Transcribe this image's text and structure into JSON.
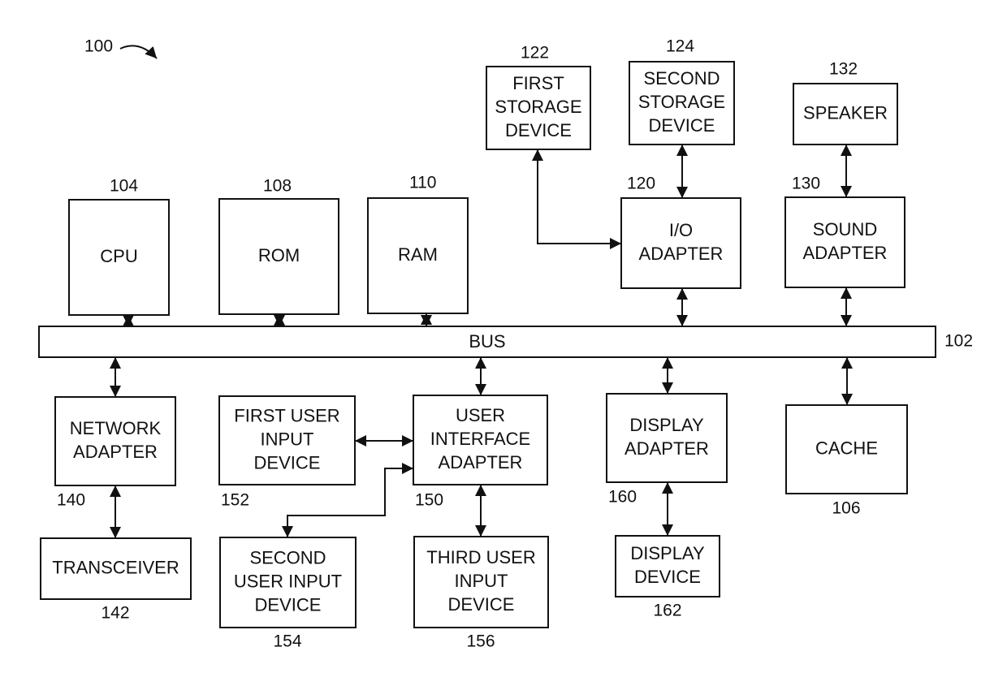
{
  "figure": {
    "ref": "100",
    "bus": {
      "ref": "102",
      "label": "BUS"
    },
    "blocks": {
      "cpu": {
        "ref": "104",
        "lines": [
          "CPU"
        ]
      },
      "rom": {
        "ref": "108",
        "lines": [
          "ROM"
        ]
      },
      "ram": {
        "ref": "110",
        "lines": [
          "RAM"
        ]
      },
      "first_storage": {
        "ref": "122",
        "lines": [
          "FIRST",
          "STORAGE",
          "DEVICE"
        ]
      },
      "second_storage": {
        "ref": "124",
        "lines": [
          "SECOND",
          "STORAGE",
          "DEVICE"
        ]
      },
      "speaker": {
        "ref": "132",
        "lines": [
          "SPEAKER"
        ]
      },
      "io_adapter": {
        "ref": "120",
        "lines": [
          "I/O",
          "ADAPTER"
        ]
      },
      "sound_adapter": {
        "ref": "130",
        "lines": [
          "SOUND",
          "ADAPTER"
        ]
      },
      "network_adapter": {
        "ref": "140",
        "lines": [
          "NETWORK",
          "ADAPTER"
        ]
      },
      "first_uid": {
        "ref": "152",
        "lines": [
          "FIRST USER",
          "INPUT",
          "DEVICE"
        ]
      },
      "ui_adapter": {
        "ref": "150",
        "lines": [
          "USER",
          "INTERFACE",
          "ADAPTER"
        ]
      },
      "display_adapter": {
        "ref": "160",
        "lines": [
          "DISPLAY",
          "ADAPTER"
        ]
      },
      "cache": {
        "ref": "106",
        "lines": [
          "CACHE"
        ]
      },
      "transceiver": {
        "ref": "142",
        "lines": [
          "TRANSCEIVER"
        ]
      },
      "second_uid": {
        "ref": "154",
        "lines": [
          "SECOND",
          "USER INPUT",
          "DEVICE"
        ]
      },
      "third_uid": {
        "ref": "156",
        "lines": [
          "THIRD USER",
          "INPUT",
          "DEVICE"
        ]
      },
      "display_device": {
        "ref": "162",
        "lines": [
          "DISPLAY",
          "DEVICE"
        ]
      }
    },
    "connections": [
      {
        "from": "cpu",
        "to": "bus",
        "direction": "bidirectional"
      },
      {
        "from": "rom",
        "to": "bus",
        "direction": "bidirectional"
      },
      {
        "from": "ram",
        "to": "bus",
        "direction": "bidirectional"
      },
      {
        "from": "io_adapter",
        "to": "bus",
        "direction": "bidirectional"
      },
      {
        "from": "sound_adapter",
        "to": "bus",
        "direction": "bidirectional"
      },
      {
        "from": "second_storage",
        "to": "io_adapter",
        "direction": "bidirectional"
      },
      {
        "from": "first_storage",
        "to": "io_adapter",
        "direction": "bidirectional"
      },
      {
        "from": "speaker",
        "to": "sound_adapter",
        "direction": "bidirectional"
      },
      {
        "from": "bus",
        "to": "network_adapter",
        "direction": "bidirectional"
      },
      {
        "from": "bus",
        "to": "ui_adapter",
        "direction": "bidirectional"
      },
      {
        "from": "bus",
        "to": "display_adapter",
        "direction": "bidirectional"
      },
      {
        "from": "bus",
        "to": "cache",
        "direction": "bidirectional"
      },
      {
        "from": "network_adapter",
        "to": "transceiver",
        "direction": "bidirectional"
      },
      {
        "from": "first_uid",
        "to": "ui_adapter",
        "direction": "bidirectional"
      },
      {
        "from": "second_uid",
        "to": "ui_adapter",
        "direction": "bidirectional"
      },
      {
        "from": "third_uid",
        "to": "ui_adapter",
        "direction": "bidirectional"
      },
      {
        "from": "display_adapter",
        "to": "display_device",
        "direction": "bidirectional"
      }
    ]
  }
}
